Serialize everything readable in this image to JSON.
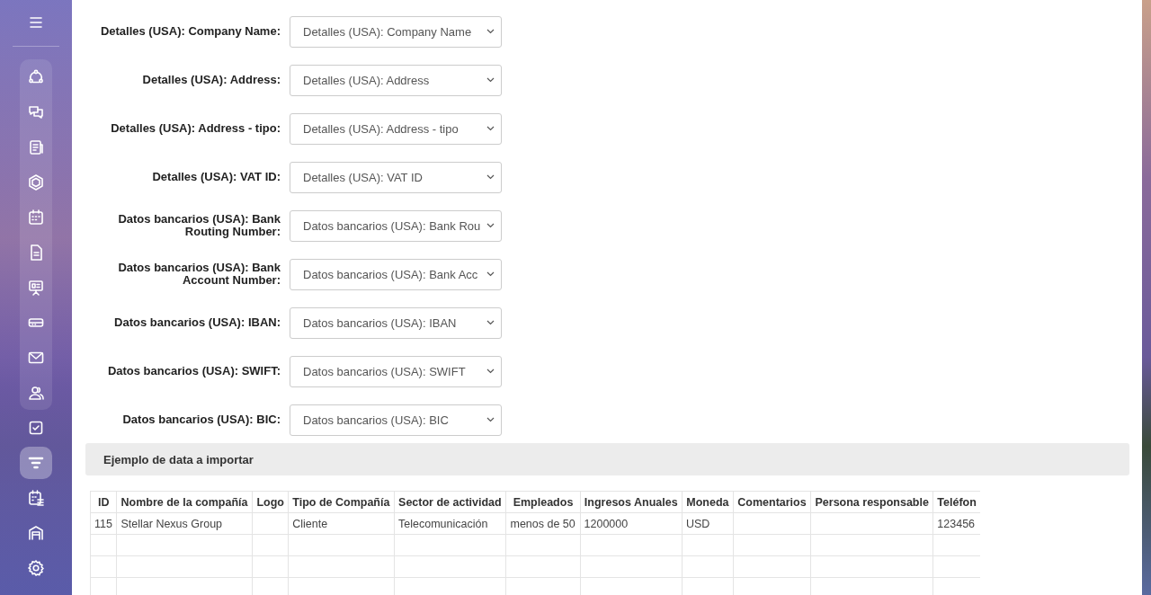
{
  "sidebar": {
    "items": [
      {
        "selected": false
      },
      {
        "selected": false
      },
      {
        "selected": false
      },
      {
        "selected": false
      },
      {
        "selected": false
      },
      {
        "selected": false
      },
      {
        "selected": false
      },
      {
        "selected": false
      },
      {
        "selected": false
      },
      {
        "selected": false
      },
      {
        "selected": false
      },
      {
        "selected": true
      },
      {
        "selected": false
      },
      {
        "selected": false
      },
      {
        "selected": false
      }
    ]
  },
  "mapping": [
    {
      "label": "Detalles (USA): Company Name:",
      "value": "Detalles (USA): Company Name"
    },
    {
      "label": "Detalles (USA): Address:",
      "value": "Detalles (USA): Address"
    },
    {
      "label": "Detalles (USA): Address - tipo:",
      "value": "Detalles (USA): Address - tipo"
    },
    {
      "label": "Detalles (USA): VAT ID:",
      "value": "Detalles (USA): VAT ID"
    },
    {
      "label": "Datos bancarios (USA): Bank Routing Number:",
      "value": "Datos bancarios (USA): Bank Rou"
    },
    {
      "label": "Datos bancarios (USA): Bank Account Number:",
      "value": "Datos bancarios (USA): Bank Acc"
    },
    {
      "label": "Datos bancarios (USA): IBAN:",
      "value": "Datos bancarios (USA): IBAN"
    },
    {
      "label": "Datos bancarios (USA): SWIFT:",
      "value": "Datos bancarios (USA): SWIFT"
    },
    {
      "label": "Datos bancarios (USA): BIC:",
      "value": "Datos bancarios (USA): BIC"
    }
  ],
  "sample": {
    "title": "Ejemplo de data a importar",
    "table": {
      "columns": [
        "ID",
        "Nombre de la compañía",
        "Logo",
        "Tipo de Compañía",
        "Sector de actividad",
        "Empleados",
        "Ingresos Anuales",
        "Moneda",
        "Comentarios",
        "Persona responsable",
        "Teléfon"
      ],
      "rows": [
        {
          "cells": [
            "115",
            "Stellar Nexus Group",
            null,
            "Cliente",
            "Telecomunicación",
            "menos de 50",
            "1200000",
            "USD",
            null,
            null,
            "123456"
          ]
        },
        {
          "cells": [
            null,
            null,
            null,
            null,
            null,
            null,
            null,
            null,
            null,
            null,
            null
          ]
        },
        {
          "cells": [
            null,
            null,
            null,
            null,
            null,
            null,
            null,
            null,
            null,
            null,
            null
          ]
        },
        {
          "cells": [
            null,
            null,
            null,
            null,
            null,
            null,
            null,
            null,
            null,
            null,
            null
          ]
        }
      ]
    }
  }
}
